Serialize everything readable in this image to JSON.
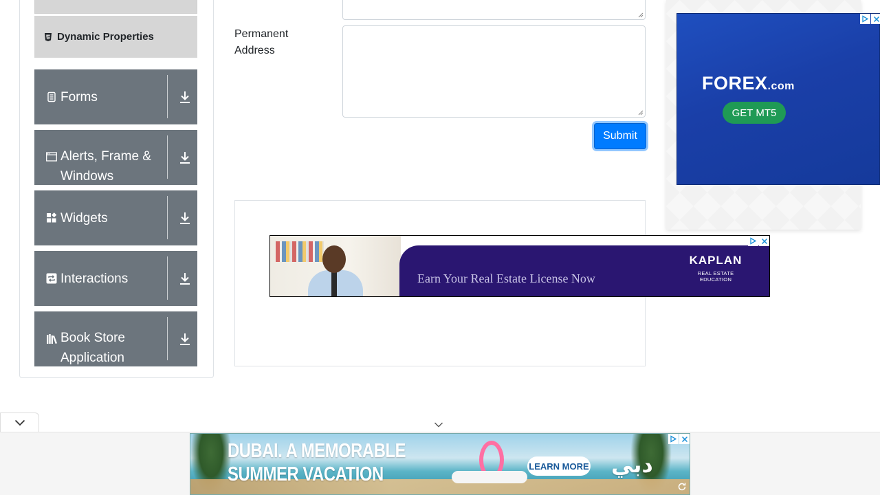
{
  "sidebar": {
    "submenu_item": {
      "label": "Dynamic Properties",
      "icon": "html5-icon"
    },
    "groups": [
      {
        "label": "Forms",
        "icon": "form-icon"
      },
      {
        "label": "Alerts, Frame & Windows",
        "icon": "window-icon"
      },
      {
        "label": "Widgets",
        "icon": "widgets-icon"
      },
      {
        "label": "Interactions",
        "icon": "interactions-icon"
      },
      {
        "label": "Book Store Application",
        "icon": "books-icon"
      }
    ]
  },
  "form": {
    "permanent_address_label": "Permanent Address",
    "current_address_value": "",
    "permanent_address_value": "",
    "submit_label": "Submit"
  },
  "ads": {
    "kaplan": {
      "tagline": "Earn Your Real Estate License Now",
      "brand": "KAPLAN",
      "sub": "REAL ESTATE EDUCATION"
    },
    "forex": {
      "logo": "FOREX",
      "logo_suffix": ".com",
      "cta": "GET MT5"
    },
    "dubai": {
      "headline_1": "DUBAI. A MEMORABLE",
      "headline_2": "SUMMER VACATION",
      "cta": "LEARN MORE",
      "brand": "دبي"
    }
  },
  "colors": {
    "group_bg": "#6c757d",
    "submenu_bg": "#d6d6d6",
    "primary": "#007bff"
  }
}
